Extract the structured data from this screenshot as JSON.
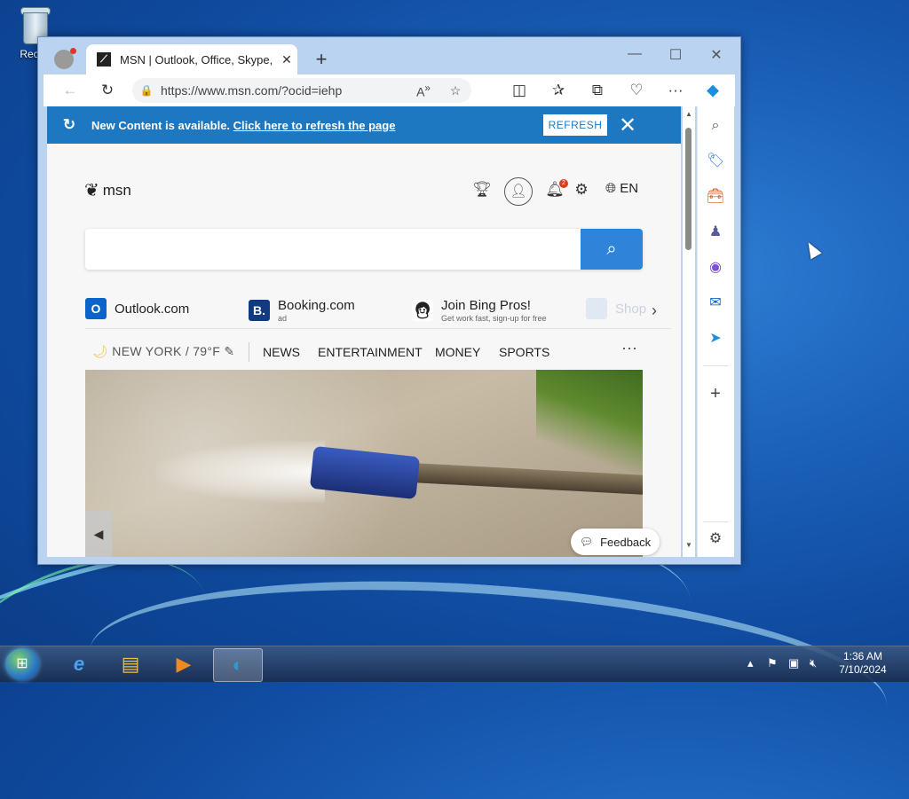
{
  "desktop": {
    "recycle_bin_label": "Recyc"
  },
  "browser": {
    "tab": {
      "title": "MSN | Outlook, Office, Skype, Bi",
      "favicon": "msn-icon",
      "close": "✕"
    },
    "new_tab": "+",
    "window_controls": {
      "minimize": "—",
      "maximize": "☐",
      "close": "✕"
    },
    "address": {
      "url": "https://www.msn.com/?ocid=iehp",
      "read_aloud": "A",
      "read_aloud_sup": "»"
    },
    "toolbar_icons": [
      "back-icon",
      "refresh-icon",
      "favorite-star-icon",
      "split-screen-icon",
      "favorites-icon",
      "collections-icon",
      "browser-essentials-icon",
      "more-icon",
      "copilot-icon"
    ]
  },
  "banner": {
    "message": "New Content is available.",
    "link": "Click here to refresh the page",
    "refresh_button": "REFRESH"
  },
  "msn": {
    "logo_text": "msn",
    "language": "EN",
    "notification_count": "2",
    "search_placeholder": ""
  },
  "quick_links": [
    {
      "name": "Outlook.com",
      "sub": "",
      "icon_letter": "O",
      "color": "#0a64c9"
    },
    {
      "name": "Booking.com",
      "sub": "ad",
      "icon_letter": "B.",
      "color": "#123a83"
    },
    {
      "name": "Join Bing Pros!",
      "sub": "Get work fast, sign-up for free",
      "icon_letter": "",
      "color": "#ffffff"
    },
    {
      "name": "Shop",
      "sub": "",
      "icon_letter": "",
      "color": "#c9d8ea"
    }
  ],
  "nav": {
    "weather": "NEW YORK / 79°F",
    "items": [
      "NEWS",
      "ENTERTAINMENT",
      "MONEY",
      "SPORTS"
    ],
    "more": "···"
  },
  "feedback_label": "Feedback",
  "taskbar": {
    "time": "1:36 AM",
    "date": "7/10/2024"
  },
  "colors": {
    "banner_blue": "#1d78c1",
    "search_button": "#2f84d9"
  }
}
